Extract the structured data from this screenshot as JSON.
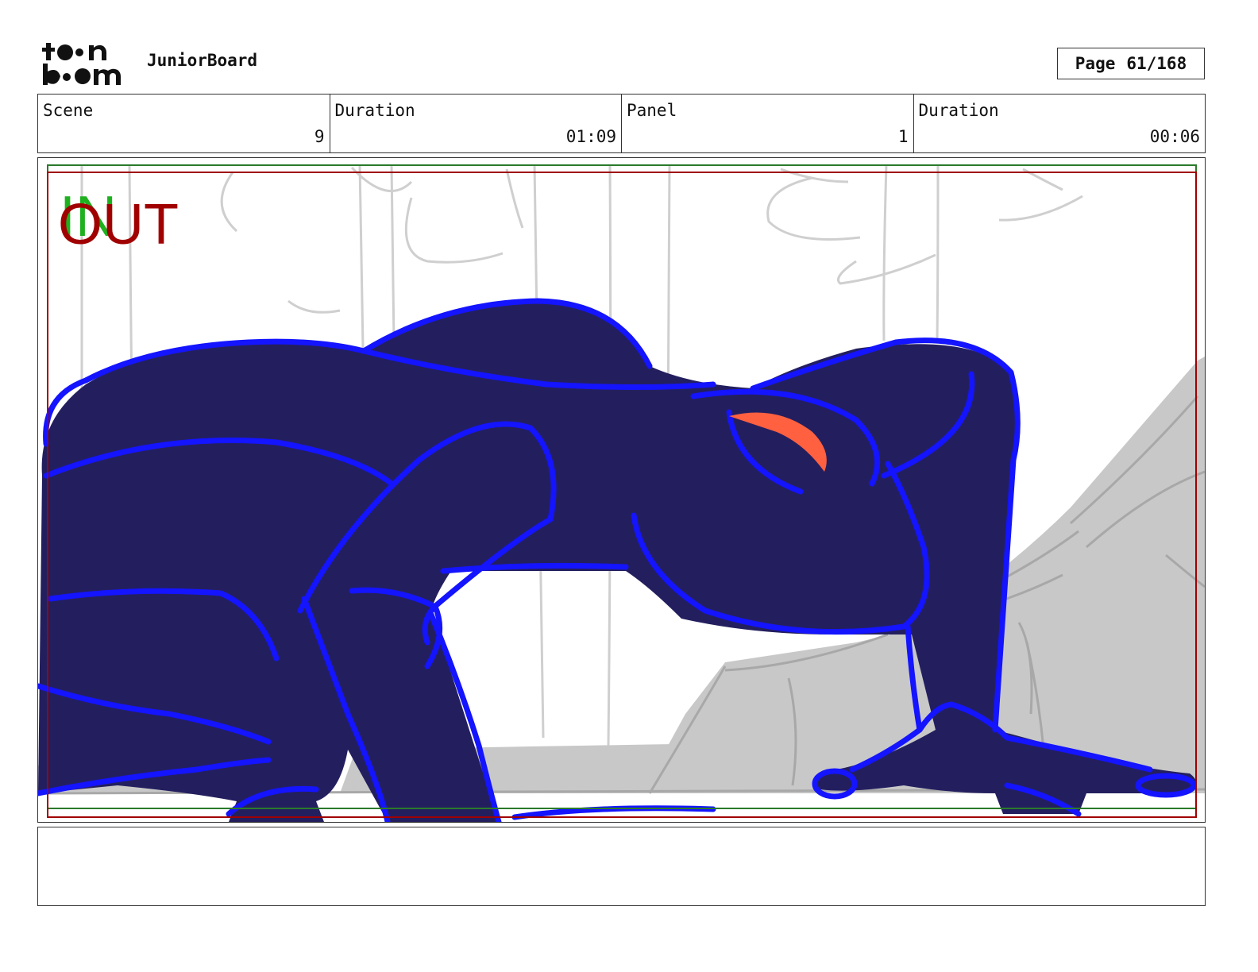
{
  "header": {
    "logo_alt": "toon boom",
    "app_title": "JuniorBoard",
    "page_label": "Page",
    "page_value": "61/168"
  },
  "info": {
    "scene_label": "Scene",
    "scene_value": "9",
    "scene_duration_label": "Duration",
    "scene_duration_value": "01:09",
    "panel_label": "Panel",
    "panel_value": "1",
    "panel_duration_label": "Duration",
    "panel_duration_value": "00:06"
  },
  "panel_markers": {
    "in_label": "IN",
    "out_label": "OUT",
    "in_color": "#1fb01f",
    "out_color": "#a00000"
  },
  "colors": {
    "frog_fill": "#231f5f",
    "frog_outline": "#1414ff",
    "eye": "#ff6040",
    "rock": "#c8c8c8",
    "sketch": "#cfcfcf"
  },
  "notes": {
    "text": ""
  }
}
